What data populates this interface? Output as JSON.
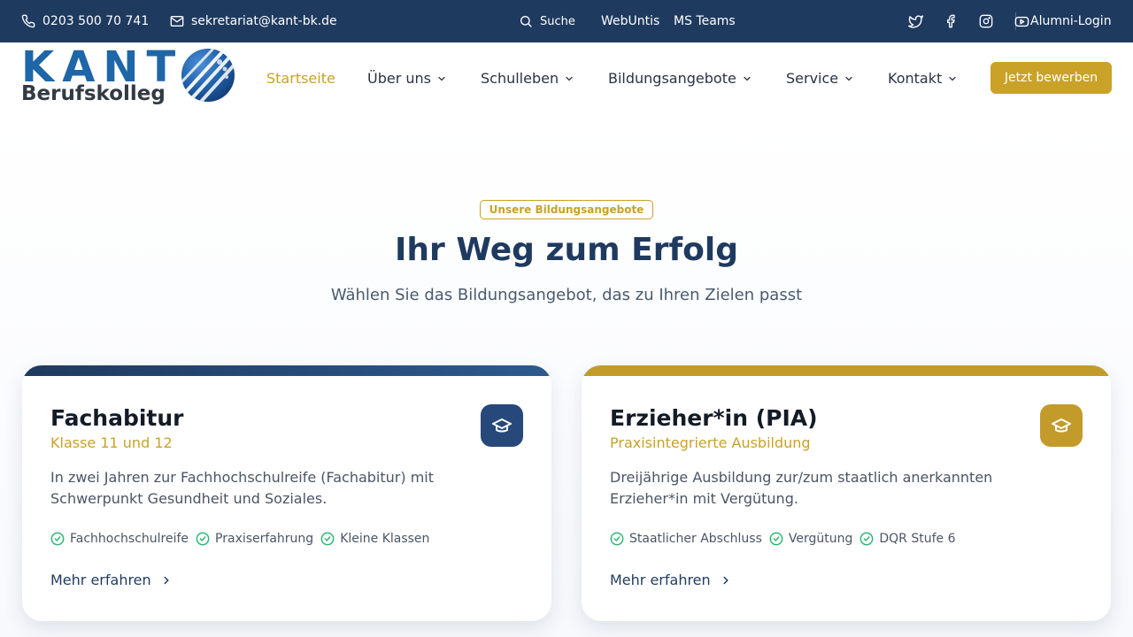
{
  "topbar": {
    "phone": "0203 500 70 741",
    "email": "sekretariat@kant-bk.de",
    "search_label": "Suche",
    "links": [
      "WebUntis",
      "MS Teams"
    ],
    "social_icons": [
      "twitter-icon",
      "facebook-icon",
      "instagram-icon",
      "youtube-icon"
    ],
    "alumni_login": "Alumni-Login"
  },
  "logo": {
    "name": "KANT",
    "sub": "Berufskolleg"
  },
  "nav": {
    "items": [
      {
        "label": "Startseite",
        "active": true,
        "dropdown": false
      },
      {
        "label": "Über uns",
        "active": false,
        "dropdown": true
      },
      {
        "label": "Schulleben",
        "active": false,
        "dropdown": true
      },
      {
        "label": "Bildungsangebote",
        "active": false,
        "dropdown": true
      },
      {
        "label": "Service",
        "active": false,
        "dropdown": true
      },
      {
        "label": "Kontakt",
        "active": false,
        "dropdown": true
      }
    ],
    "cta": "Jetzt bewerben"
  },
  "section": {
    "badge": "Unsere Bildungsangebote",
    "title": "Ihr Weg zum Erfolg",
    "subtitle": "Wählen Sie das Bildungsangebot, das zu Ihren Zielen passt"
  },
  "cards": [
    {
      "title": "Fachabitur",
      "subtitle": "Klasse 11 und 12",
      "description": "In zwei Jahren zur Fachhochschulreife (Fachabitur) mit Schwerpunkt Gesundheit und Soziales.",
      "features": [
        "Fachhochschulreife",
        "Praxiserfahrung",
        "Kleine Klassen"
      ],
      "link": "Mehr erfahren",
      "icon": "graduation-cap-icon"
    },
    {
      "title": "Erzieher*in (PIA)",
      "subtitle": "Praxisintegrierte Ausbildung",
      "description": "Dreijährige Ausbildung zur/zum staatlich anerkannten Erzieher*in mit Vergütung.",
      "features": [
        "Staatlicher Abschluss",
        "Vergütung",
        "DQR Stufe 6"
      ],
      "link": "Mehr erfahren",
      "icon": "graduation-cap-icon"
    }
  ],
  "colors": {
    "primary": "#1f3a5f",
    "accent": "#c9a227",
    "check": "#2bb673"
  }
}
